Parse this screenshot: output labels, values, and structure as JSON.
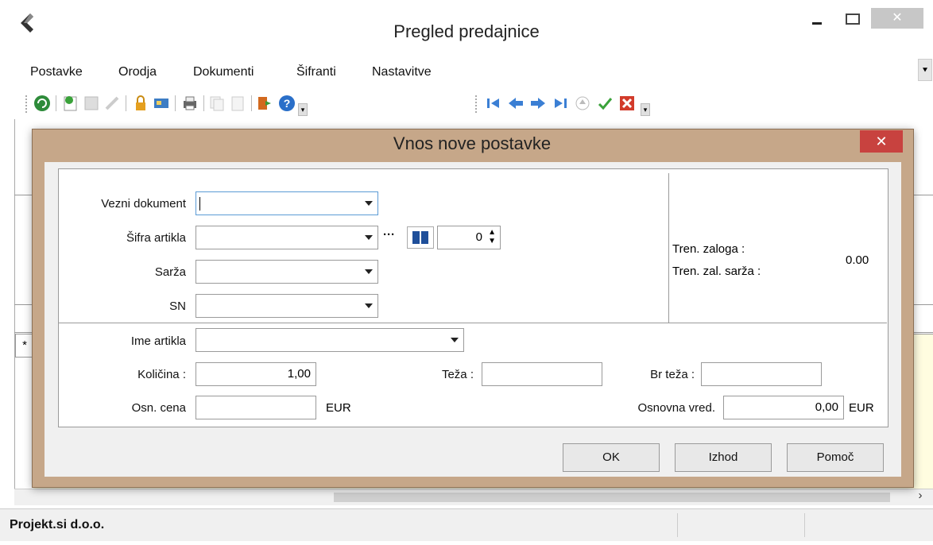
{
  "window": {
    "title": "Pregled predajnice",
    "close_glyph": "✕"
  },
  "menu": {
    "items": [
      {
        "label": "Postavke"
      },
      {
        "label": "Orodja"
      },
      {
        "label": "Dokumenti"
      },
      {
        "label": "Šifranti"
      },
      {
        "label": "Nastavitve"
      }
    ],
    "overflow_glyph": "⯆"
  },
  "toolbar": {
    "icons": [
      "refresh-icon",
      "new-icon",
      "save-icon",
      "edit-icon",
      "lock-icon",
      "card-icon",
      "print-icon",
      "copy-icon",
      "paste-icon",
      "exit-icon",
      "help-icon"
    ],
    "nav_icons": [
      "first-record-icon",
      "previous-record-icon",
      "next-record-icon",
      "last-record-icon",
      "insert-record-icon",
      "confirm-icon",
      "cancel-icon"
    ],
    "overflow_glyph": "▾"
  },
  "grid": {
    "new_row_marker": "*"
  },
  "status": {
    "company": "Projekt.si d.o.o."
  },
  "dialog": {
    "title": "Vnos nove postavke",
    "close_glyph": "✕",
    "fields": {
      "vezni_dokument": {
        "label": "Vezni dokument",
        "value": ""
      },
      "sifra_artikla": {
        "label": "Šifra artikla",
        "value": ""
      },
      "spinner_value": "0",
      "sarza": {
        "label": "Sarža",
        "value": ""
      },
      "sn": {
        "label": "SN",
        "value": ""
      },
      "ime_artikla": {
        "label": "Ime artikla",
        "value": ""
      },
      "kolicina": {
        "label": "Količina :",
        "value": "1,00"
      },
      "teza": {
        "label": "Teža :",
        "value": ""
      },
      "br_teza": {
        "label": "Br teža :",
        "value": ""
      },
      "osn_cena": {
        "label": "Osn. cena",
        "value": "",
        "currency": "EUR"
      },
      "osnovna_vred": {
        "label": "Osnovna vred.",
        "value": "0,00",
        "currency": "EUR"
      }
    },
    "stock": {
      "tren_zaloga_label": "Tren. zaloga :",
      "tren_zal_sarza_label": "Tren. zal. sarža :",
      "value": "0.00"
    },
    "buttons": {
      "ok": "OK",
      "exit": "Izhod",
      "help": "Pomoč"
    },
    "ellipsis": "···"
  },
  "colors": {
    "dialog_frame": "#c6a789",
    "close_red": "#c8423f",
    "grid_new_row": "#fffde0"
  }
}
